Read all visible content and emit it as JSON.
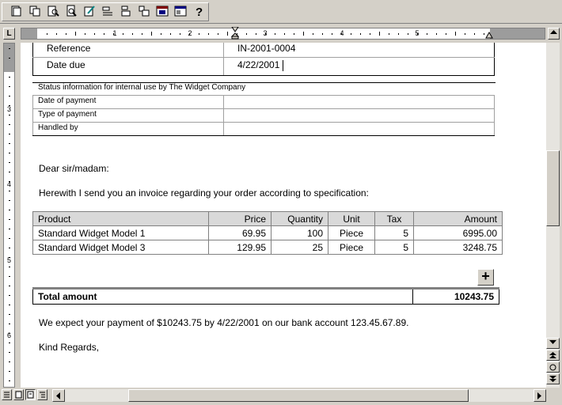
{
  "toolbar": {
    "buttons": [
      "new-document-icon",
      "copy-icon",
      "zoom-page-icon",
      "print-preview-icon",
      "edit-icon",
      "outdent-icon",
      "indent-icon",
      "split-icon",
      "calendar-icon",
      "window-icon",
      "help-icon"
    ]
  },
  "rulers": {
    "horizontal_numbers": [
      "1",
      "2",
      "3",
      "4",
      "5"
    ],
    "vertical_numbers": [
      "3",
      "4",
      "5",
      "6"
    ],
    "tab_selector": "L"
  },
  "document": {
    "reference_label": "Reference",
    "reference_value": "IN-2001-0004",
    "date_due_label": "Date due",
    "date_due_value": "4/22/2001",
    "status_title": "Status information for internal use by The Widget Company",
    "status_rows": [
      "Date of payment",
      "Type of payment",
      "Handled by"
    ],
    "salutation": "Dear sir/madam:",
    "intro": "Herewith I send you an invoice regarding your order according to specification:",
    "items_headers": {
      "product": "Product",
      "price": "Price",
      "quantity": "Quantity",
      "unit": "Unit",
      "tax": "Tax",
      "amount": "Amount"
    },
    "items": [
      {
        "product": "Standard Widget Model 1",
        "price": "69.95",
        "quantity": "100",
        "unit": "Piece",
        "tax": "5",
        "amount": "6995.00"
      },
      {
        "product": "Standard Widget Model 3",
        "price": "129.95",
        "quantity": "25",
        "unit": "Piece",
        "tax": "5",
        "amount": "3248.75"
      }
    ],
    "add_row_label": "+",
    "total_label": "Total amount",
    "total_value": "10243.75",
    "payment_note": "We expect your payment of $10243.75 by 4/22/2001 on our bank account 123.45.67.89.",
    "closing": "Kind Regards,"
  },
  "colors": {
    "chrome": "#d4d0c8",
    "ruler_margin": "#9c9c9c",
    "table_header": "#d9d9d9"
  }
}
